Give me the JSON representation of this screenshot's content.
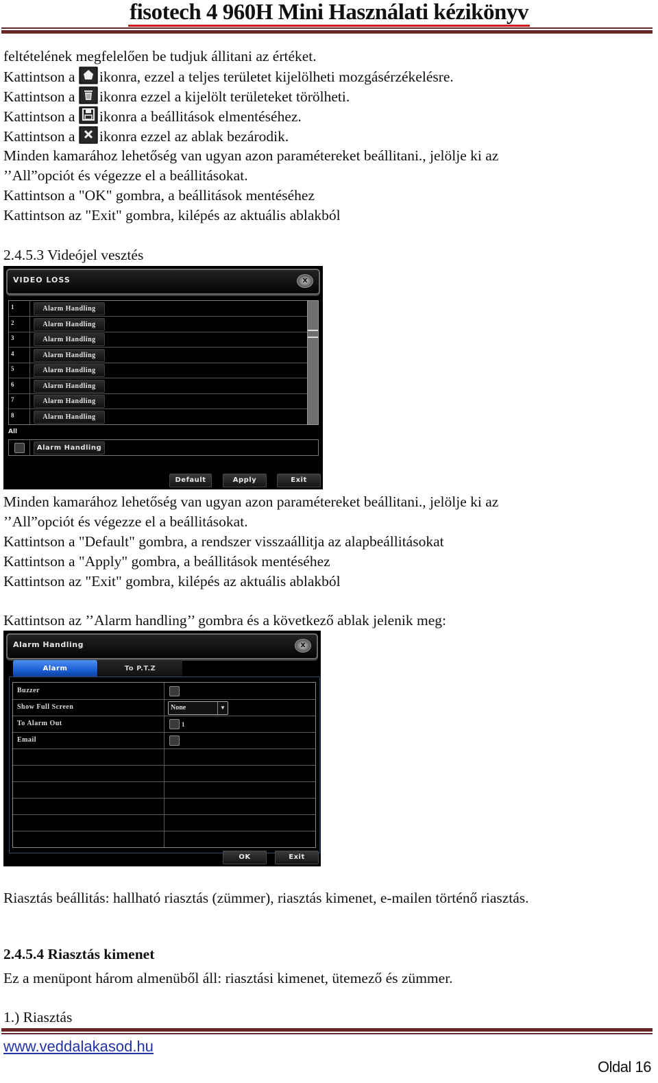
{
  "header": {
    "title": "fisotech 4 960H Mini Használati kézikönyv"
  },
  "intro": {
    "line0": "feltételének megfelelően be tudjuk állitani az értéket.",
    "icon_lines": [
      {
        "prefix": "Kattintson a",
        "icon": "home-star-icon",
        "text": "ikonra, ezzel a teljes területet kijelölheti mozgásérzékelésre."
      },
      {
        "prefix": "Kattintson a",
        "icon": "trash-icon",
        "text": "ikonra ezzel a kijelölt területeket törölheti."
      },
      {
        "prefix": "Kattintson a",
        "icon": "save-floppy-icon",
        "text": "ikonra a beállitások elmentéséhez."
      },
      {
        "prefix": "Kattintson a",
        "icon": "close-x-icon",
        "text": "ikonra ezzel az ablak bezárodik."
      }
    ],
    "line5": "Minden kamarához lehetőség van ugyan azon paramétereket beállitani., jelölje ki az",
    "line6": "’’All”opciót és végezze el a beállitásokat.",
    "line7": "Kattintson a \"OK\" gombra, a beállitások mentéséhez",
    "line8": "Kattintson az \"Exit\" gombra, kilépés az aktuális ablakból"
  },
  "section_video_loss": {
    "heading": "2.4.5.3 Videójel vesztés"
  },
  "video_loss_window": {
    "title": "VIDEO LOSS",
    "close_label": "x",
    "rows": [
      {
        "num": "1",
        "button": "Alarm Handling"
      },
      {
        "num": "2",
        "button": "Alarm Handling"
      },
      {
        "num": "3",
        "button": "Alarm Handling"
      },
      {
        "num": "4",
        "button": "Alarm Handling"
      },
      {
        "num": "5",
        "button": "Alarm Handling"
      },
      {
        "num": "6",
        "button": "Alarm Handling"
      },
      {
        "num": "7",
        "button": "Alarm Handling"
      },
      {
        "num": "8",
        "button": "Alarm Handling"
      }
    ],
    "all_label": "All",
    "all_button": "Alarm Handling",
    "buttons": {
      "default": "Default",
      "apply": "Apply",
      "exit": "Exit"
    }
  },
  "after_video_loss": {
    "line1": "Minden kamarához lehetőség van ugyan azon paramétereket beállitani., jelölje ki az",
    "line2": "’’All”opciót és végezze el a beállitásokat.",
    "line3": "Kattintson a \"Default\" gombra, a rendszer visszaállitja az alapbeállitásokat",
    "line4": "Kattintson a \"Apply\" gombra, a beállitások mentéséhez",
    "line5": "Kattintson az \"Exit\" gombra, kilépés az aktuális ablakból",
    "line6": "Kattintson az ’’Alarm handling’’ gombra és a következő ablak jelenik meg:"
  },
  "alarm_handling_window": {
    "title": "Alarm Handling",
    "close_label": "x",
    "tabs": [
      {
        "label": "Alarm",
        "active": true
      },
      {
        "label": "To P.T.Z",
        "active": false
      }
    ],
    "rows": [
      {
        "label": "Buzzer",
        "type": "checkbox",
        "checked": false
      },
      {
        "label": "Show Full Screen",
        "type": "select",
        "value": "None"
      },
      {
        "label": "To Alarm Out",
        "type": "checkbox",
        "checked": false,
        "suffix": "1"
      },
      {
        "label": "Email",
        "type": "checkbox",
        "checked": false
      }
    ],
    "buttons": {
      "ok": "OK",
      "exit": "Exit"
    },
    "accent_color": "#1a5fd6"
  },
  "after_alarm": {
    "line1": "Riasztás beállitás: hallható riasztás (zümmer), riasztás kimenet, e-mailen történő riasztás."
  },
  "section_alarm_out": {
    "heading": "2.4.5.4 Riasztás kimenet",
    "line1": "Ez a menüpont három almenüből áll: riasztási kimenet, ütemező és zümmer.",
    "line2": "1.) Riasztás"
  },
  "footer": {
    "link": "www.veddalakasod.hu",
    "page": "Oldal 16"
  }
}
